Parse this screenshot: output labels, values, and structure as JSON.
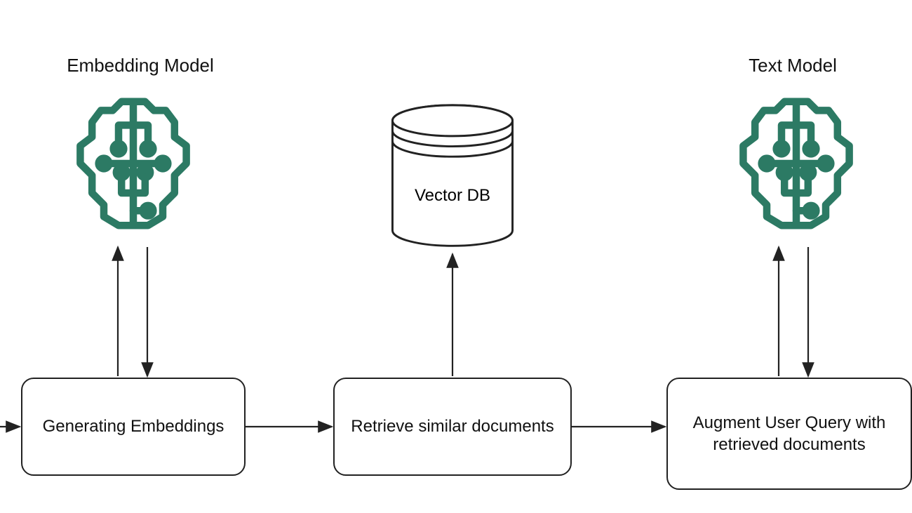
{
  "diagram": {
    "type": "flow",
    "title_left": "Embedding Model",
    "title_right": "Text Model",
    "db_label": "Vector DB",
    "nodes": {
      "generate_embeddings": "Generating Embeddings",
      "retrieve_similar": "Retrieve similar documents",
      "augment_query": "Augment User Query with retrieved documents"
    },
    "icons": {
      "brain_left": "ai-brain-icon",
      "brain_right": "ai-brain-icon",
      "database": "database-cylinder-icon"
    },
    "connections": [
      {
        "from": "offscreen-left",
        "to": "generate_embeddings",
        "type": "arrow"
      },
      {
        "from": "generate_embeddings",
        "to": "retrieve_similar",
        "type": "arrow"
      },
      {
        "from": "retrieve_similar",
        "to": "augment_query",
        "type": "arrow"
      },
      {
        "from": "generate_embeddings",
        "to": "embedding_model",
        "type": "bidirectional"
      },
      {
        "from": "retrieve_similar",
        "to": "vector_db",
        "type": "arrow-up"
      },
      {
        "from": "augment_query",
        "to": "text_model",
        "type": "bidirectional"
      }
    ],
    "colors": {
      "stroke": "#222222",
      "brain": "#2c7a64"
    }
  }
}
